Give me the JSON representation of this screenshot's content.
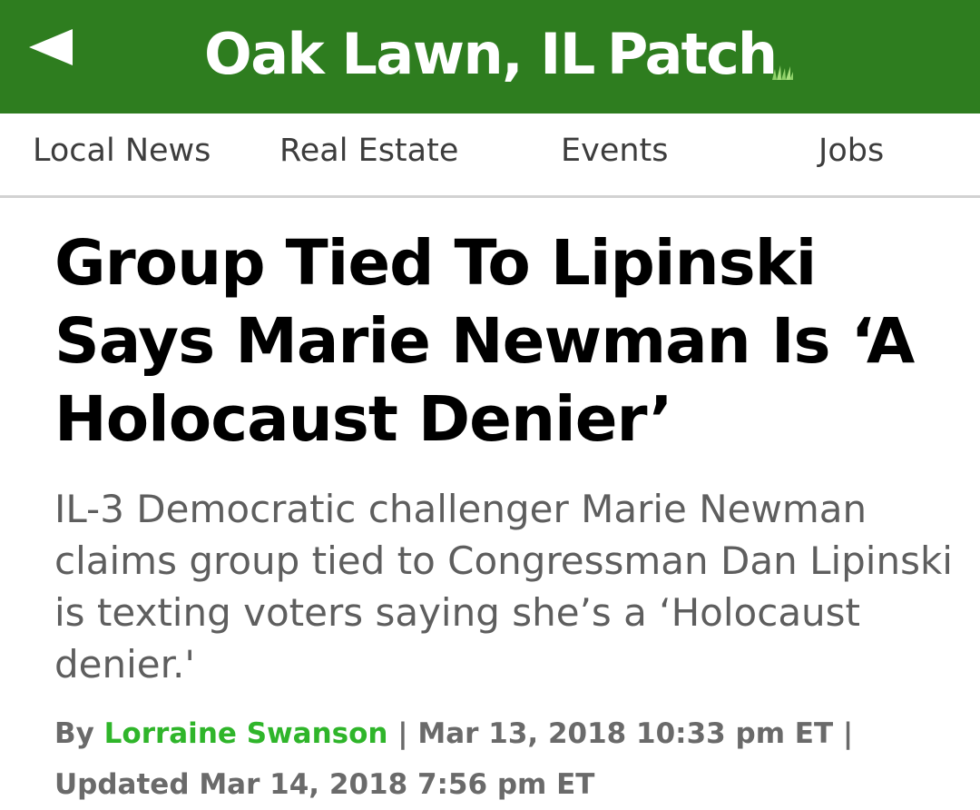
{
  "header": {
    "back_icon": "back-arrow-icon",
    "city": "Oak Lawn, IL",
    "brand": "Patch",
    "grass_icon": "grass-icon",
    "bg_color": "#2e7d1f"
  },
  "nav": {
    "items": [
      {
        "label": "Local News"
      },
      {
        "label": "Real Estate"
      },
      {
        "label": "Events"
      },
      {
        "label": "Jobs"
      }
    ]
  },
  "article": {
    "headline": "Group Tied To Lipinski Says Marie Newman Is ‘A Holocaust Denier’",
    "dek": "IL-3 Democratic challenger Marie Newman claims group tied to Congressman Dan Lipinski is texting voters saying she’s a ‘Holocaust denier.'",
    "byline": {
      "by": "By",
      "author": "Lorraine Swanson",
      "separator1": "|",
      "published": "Mar 13, 2018 10:33 pm ET",
      "separator2": "|",
      "updated_label": "Updated",
      "updated": "Mar 14, 2018 7:56 pm ET",
      "author_color": "#2fb52a"
    }
  }
}
